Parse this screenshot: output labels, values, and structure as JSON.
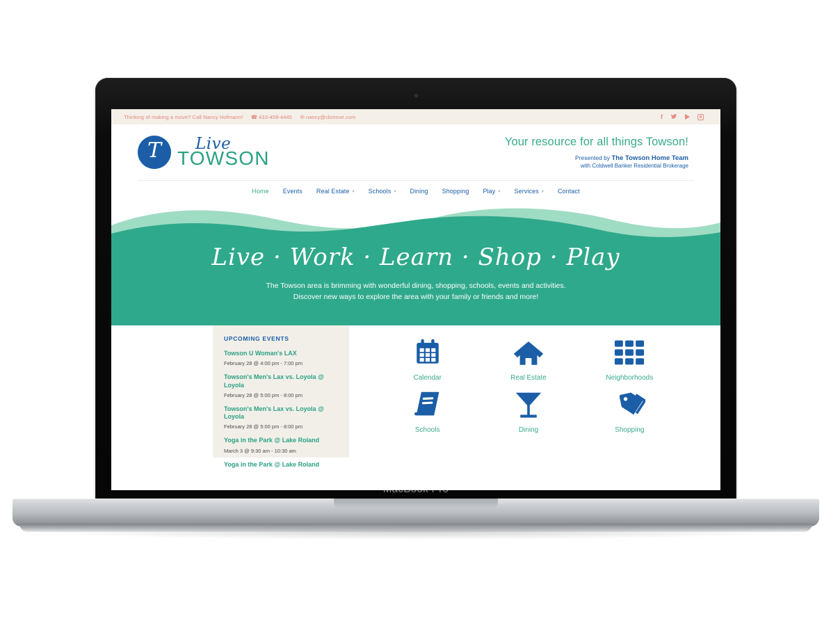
{
  "device": {
    "model_label": "MacBook Pro"
  },
  "site": {
    "topbar": {
      "message": "Thinking of making a move? Call Nancy Hofmann!",
      "phone_icon": "phone-icon",
      "phone": "410-459-4445",
      "email_icon": "envelope-icon",
      "email": "nancy@cbmove.com",
      "socials": [
        {
          "name": "facebook-icon",
          "glyph": "f"
        },
        {
          "name": "twitter-icon",
          "glyph": "ᴠ"
        },
        {
          "name": "youtube-icon",
          "glyph": "▶"
        },
        {
          "name": "instagram-icon",
          "glyph": "□"
        }
      ]
    },
    "brand": {
      "mark_letter": "T",
      "word_script": "Live",
      "word_bold": "TOWSON"
    },
    "tagline": {
      "main": "Your resource for all things Towson!",
      "presented_prefix": "Presented by ",
      "presented_name": "The Towson Home Team",
      "brokerage": "with Coldwell Banker Residential Brokerage"
    },
    "nav": [
      {
        "label": "Home",
        "active": true,
        "dropdown": false
      },
      {
        "label": "Events",
        "active": false,
        "dropdown": false
      },
      {
        "label": "Real Estate",
        "active": false,
        "dropdown": true
      },
      {
        "label": "Schools",
        "active": false,
        "dropdown": true
      },
      {
        "label": "Dining",
        "active": false,
        "dropdown": false
      },
      {
        "label": "Shopping",
        "active": false,
        "dropdown": false
      },
      {
        "label": "Play",
        "active": false,
        "dropdown": true
      },
      {
        "label": "Services",
        "active": false,
        "dropdown": true
      },
      {
        "label": "Contact",
        "active": false,
        "dropdown": false
      }
    ],
    "hero": {
      "title": "Live · Work · Learn · Shop · Play",
      "subtitle_line1": "The Towson area is brimming with wonderful dining, shopping, schools, events and activities.",
      "subtitle_line2": "Discover new ways to explore the area with your family or friends and more!"
    },
    "events": {
      "heading": "UPCOMING EVENTS",
      "items": [
        {
          "title": "Towson U Woman's LAX",
          "date": "February 28 @ 4:00 pm - 7:00 pm"
        },
        {
          "title": "Towson's Men's Lax vs. Loyola @ Loyola",
          "date": "February 28 @ 5:00 pm - 8:00 pm"
        },
        {
          "title": "Towson's Men's Lax vs. Loyola @ Loyola",
          "date": "February 28 @ 5:00 pm - 8:00 pm"
        },
        {
          "title": "Yoga in the Park @ Lake Roland",
          "date": "March 3 @ 9:30 am - 10:30 am"
        },
        {
          "title": "Yoga in the Park @ Lake Roland",
          "date": ""
        }
      ]
    },
    "tiles": [
      {
        "label": "Calendar",
        "icon": "calendar-icon"
      },
      {
        "label": "Real Estate",
        "icon": "house-icon"
      },
      {
        "label": "Neighborhoods",
        "icon": "grid-icon"
      },
      {
        "label": "Schools",
        "icon": "book-icon"
      },
      {
        "label": "Dining",
        "icon": "martini-glass-icon"
      },
      {
        "label": "Shopping",
        "icon": "price-tags-icon"
      }
    ],
    "colors": {
      "teal": "#2fa98b",
      "green_text": "#3aab8c",
      "blue": "#1b5ea7",
      "coral": "#e2877a",
      "beige": "#f2efe9",
      "topbar_bg": "#f4efe9"
    }
  }
}
